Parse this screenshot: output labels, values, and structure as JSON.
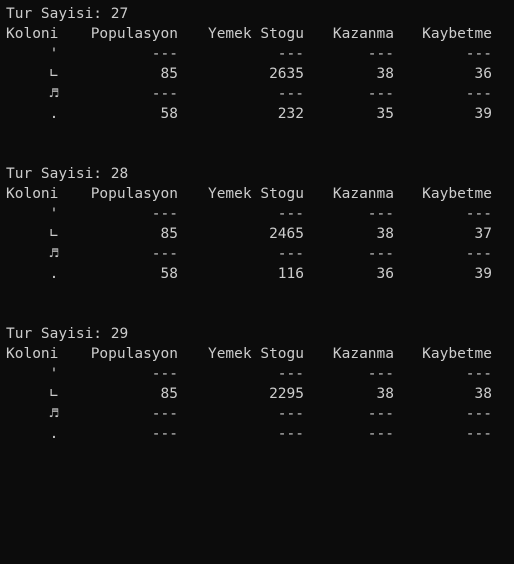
{
  "headers": {
    "koloni": "Koloni",
    "populasyon": "Populasyon",
    "yemek": "Yemek Stogu",
    "kazanma": "Kazanma",
    "kaybetme": "Kaybetme"
  },
  "blocks": [
    {
      "title": "Tur Sayisi: 27",
      "rows": [
        {
          "symbol": "'",
          "populasyon": "---",
          "yemek": "---",
          "kazanma": "---",
          "kaybetme": "---"
        },
        {
          "symbol": "∟",
          "populasyon": "85",
          "yemek": "2635",
          "kazanma": "38",
          "kaybetme": "36"
        },
        {
          "symbol": "♬",
          "populasyon": "---",
          "yemek": "---",
          "kazanma": "---",
          "kaybetme": "---"
        },
        {
          "symbol": ".",
          "populasyon": "58",
          "yemek": "232",
          "kazanma": "35",
          "kaybetme": "39"
        }
      ]
    },
    {
      "title": "Tur Sayisi: 28",
      "rows": [
        {
          "symbol": "'",
          "populasyon": "---",
          "yemek": "---",
          "kazanma": "---",
          "kaybetme": "---"
        },
        {
          "symbol": "∟",
          "populasyon": "85",
          "yemek": "2465",
          "kazanma": "38",
          "kaybetme": "37"
        },
        {
          "symbol": "♬",
          "populasyon": "---",
          "yemek": "---",
          "kazanma": "---",
          "kaybetme": "---"
        },
        {
          "symbol": ".",
          "populasyon": "58",
          "yemek": "116",
          "kazanma": "36",
          "kaybetme": "39"
        }
      ]
    },
    {
      "title": "Tur Sayisi: 29",
      "rows": [
        {
          "symbol": "'",
          "populasyon": "---",
          "yemek": "---",
          "kazanma": "---",
          "kaybetme": "---"
        },
        {
          "symbol": "∟",
          "populasyon": "85",
          "yemek": "2295",
          "kazanma": "38",
          "kaybetme": "38"
        },
        {
          "symbol": "♬",
          "populasyon": "---",
          "yemek": "---",
          "kazanma": "---",
          "kaybetme": "---"
        },
        {
          "symbol": ".",
          "populasyon": "---",
          "yemek": "---",
          "kazanma": "---",
          "kaybetme": "---"
        }
      ]
    }
  ]
}
